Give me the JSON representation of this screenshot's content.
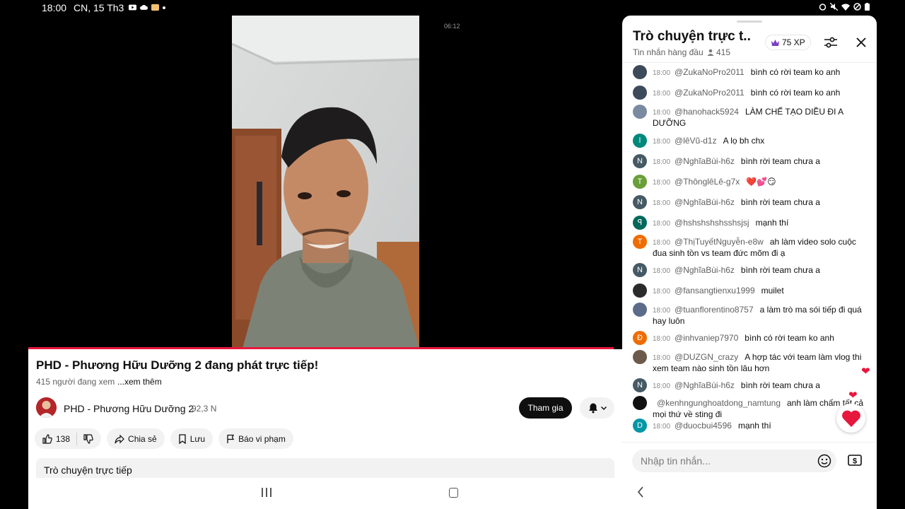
{
  "status_bar": {
    "time": "18:00",
    "date": "CN, 15 Th3"
  },
  "video": {
    "timestamp": "06:12"
  },
  "info": {
    "title": "PHD - Phương Hữu Dưỡng 2 đang phát trực tiếp!",
    "viewers": "415 người đang xem",
    "more": "...xem thêm",
    "channel_name": "PHD - Phương Hữu Dưỡng 2",
    "subscribers": "92,3 N",
    "join_label": "Tham gia",
    "like_count": "138",
    "share_label": "Chia sẻ",
    "save_label": "Lưu",
    "report_label": "Báo vi phạm",
    "chat_replay_label": "Trò chuyện trực tiếp"
  },
  "chat": {
    "title": "Trò chuyện trực t...",
    "subtitle": "Tin nhắn hàng đầu",
    "viewer_count": "415",
    "xp_label": "75 XP",
    "input_placeholder": "Nhập tin nhắn...",
    "messages": [
      {
        "time": "18:00",
        "user": "@ZukaNoPro2011",
        "text": "bình có rời team ko anh",
        "avatar_letter": "",
        "avatar_color": "#3d4a5a"
      },
      {
        "time": "18:00",
        "user": "@ZukaNoPro2011",
        "text": "bình có rời team ko anh",
        "avatar_letter": "",
        "avatar_color": "#3d4a5a"
      },
      {
        "time": "18:00",
        "user": "@hanohack5924",
        "text": "LÀM CHẾ TẠO DIỀU ĐI A DƯỠNG",
        "avatar_letter": "",
        "avatar_color": "#7a8aa0"
      },
      {
        "time": "18:00",
        "user": "@lêVũ-d1z",
        "text": "A lọ bh chx",
        "avatar_letter": "l",
        "avatar_color": "#00897b"
      },
      {
        "time": "18:00",
        "user": "@NghĩaBùi-h6z",
        "text": "bình rời team chưa a",
        "avatar_letter": "N",
        "avatar_color": "#455a64"
      },
      {
        "time": "18:00",
        "user": "@ThônglêLê-g7x",
        "text": "❤️💕😏",
        "avatar_letter": "T",
        "avatar_color": "#689f38"
      },
      {
        "time": "18:00",
        "user": "@NghĩaBùi-h6z",
        "text": "bình rời team chưa a",
        "avatar_letter": "N",
        "avatar_color": "#455a64"
      },
      {
        "time": "18:00",
        "user": "@hshshshshsshsjsj",
        "text": "mạnh thí",
        "avatar_letter": "ꟼ",
        "avatar_color": "#00695c"
      },
      {
        "time": "18:00",
        "user": "@ThịTuyếtNguyễn-e8w",
        "text": "ah làm video solo cuộc đua sinh tồn vs team đức mõm đi ạ",
        "avatar_letter": "T",
        "avatar_color": "#ef6c00"
      },
      {
        "time": "18:00",
        "user": "@NghĩaBùi-h6z",
        "text": "bình rời team chưa a",
        "avatar_letter": "N",
        "avatar_color": "#455a64"
      },
      {
        "time": "18:00",
        "user": "@fansangtienxu1999",
        "text": "muilet",
        "avatar_letter": "",
        "avatar_color": "#2b2b2b"
      },
      {
        "time": "18:00",
        "user": "@tuanflorentino8757",
        "text": "a làm trò ma sói tiếp đi quá hay luôn",
        "avatar_letter": "",
        "avatar_color": "#5c6b8a"
      },
      {
        "time": "18:00",
        "user": "@inhvaniep7970",
        "text": "bình có rời team ko anh",
        "avatar_letter": "Đ",
        "avatar_color": "#ef6c00"
      },
      {
        "time": "18:00",
        "user": "@DUZGN_crazy",
        "text": "A hợp tác với team làm vlog thi xem team nào sinh tồn lâu hơn",
        "avatar_letter": "",
        "avatar_color": "#6d5a4a"
      },
      {
        "time": "18:00",
        "user": "@NghĩaBùi-h6z",
        "text": "bình rời team chưa a",
        "avatar_letter": "N",
        "avatar_color": "#455a64"
      },
      {
        "time": "",
        "user": "@kenhngunghoatdong_namtung",
        "text": "anh làm chấm tất cả mọi thứ về sting đi",
        "avatar_letter": "",
        "avatar_color": "#111111"
      },
      {
        "time": "18:00",
        "user": "@duocbui4596",
        "text": "mạnh thí",
        "avatar_letter": "D",
        "avatar_color": "#0097a7"
      }
    ]
  },
  "colors": {
    "accent_red": "#e8173d",
    "join_bg": "#0f0f0f",
    "xp_crown": "#7b3fc4"
  }
}
